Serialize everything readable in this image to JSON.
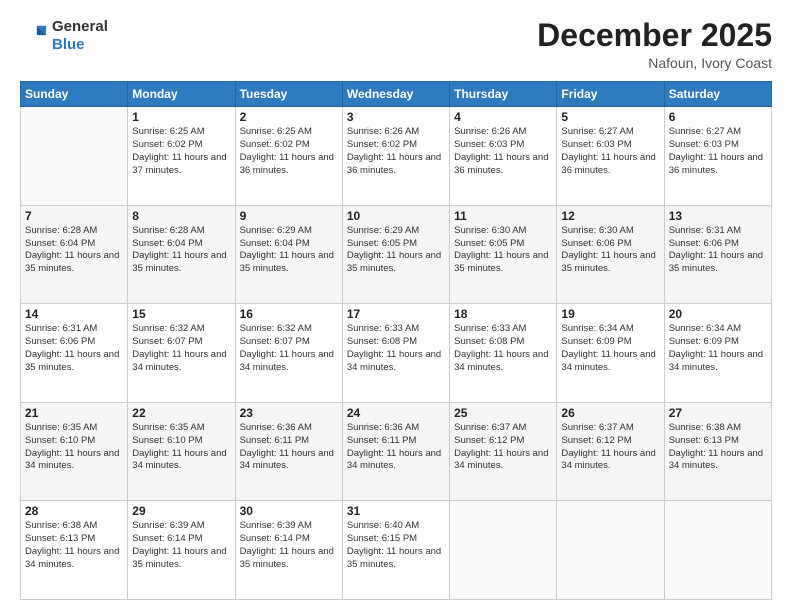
{
  "logo": {
    "general": "General",
    "blue": "Blue"
  },
  "header": {
    "month": "December 2025",
    "location": "Nafoun, Ivory Coast"
  },
  "weekdays": [
    "Sunday",
    "Monday",
    "Tuesday",
    "Wednesday",
    "Thursday",
    "Friday",
    "Saturday"
  ],
  "weeks": [
    [
      {
        "day": "",
        "empty": true
      },
      {
        "day": "1",
        "sunrise": "Sunrise: 6:25 AM",
        "sunset": "Sunset: 6:02 PM",
        "daylight": "Daylight: 11 hours and 37 minutes."
      },
      {
        "day": "2",
        "sunrise": "Sunrise: 6:25 AM",
        "sunset": "Sunset: 6:02 PM",
        "daylight": "Daylight: 11 hours and 36 minutes."
      },
      {
        "day": "3",
        "sunrise": "Sunrise: 6:26 AM",
        "sunset": "Sunset: 6:02 PM",
        "daylight": "Daylight: 11 hours and 36 minutes."
      },
      {
        "day": "4",
        "sunrise": "Sunrise: 6:26 AM",
        "sunset": "Sunset: 6:03 PM",
        "daylight": "Daylight: 11 hours and 36 minutes."
      },
      {
        "day": "5",
        "sunrise": "Sunrise: 6:27 AM",
        "sunset": "Sunset: 6:03 PM",
        "daylight": "Daylight: 11 hours and 36 minutes."
      },
      {
        "day": "6",
        "sunrise": "Sunrise: 6:27 AM",
        "sunset": "Sunset: 6:03 PM",
        "daylight": "Daylight: 11 hours and 36 minutes."
      }
    ],
    [
      {
        "day": "7",
        "sunrise": "Sunrise: 6:28 AM",
        "sunset": "Sunset: 6:04 PM",
        "daylight": "Daylight: 11 hours and 35 minutes."
      },
      {
        "day": "8",
        "sunrise": "Sunrise: 6:28 AM",
        "sunset": "Sunset: 6:04 PM",
        "daylight": "Daylight: 11 hours and 35 minutes."
      },
      {
        "day": "9",
        "sunrise": "Sunrise: 6:29 AM",
        "sunset": "Sunset: 6:04 PM",
        "daylight": "Daylight: 11 hours and 35 minutes."
      },
      {
        "day": "10",
        "sunrise": "Sunrise: 6:29 AM",
        "sunset": "Sunset: 6:05 PM",
        "daylight": "Daylight: 11 hours and 35 minutes."
      },
      {
        "day": "11",
        "sunrise": "Sunrise: 6:30 AM",
        "sunset": "Sunset: 6:05 PM",
        "daylight": "Daylight: 11 hours and 35 minutes."
      },
      {
        "day": "12",
        "sunrise": "Sunrise: 6:30 AM",
        "sunset": "Sunset: 6:06 PM",
        "daylight": "Daylight: 11 hours and 35 minutes."
      },
      {
        "day": "13",
        "sunrise": "Sunrise: 6:31 AM",
        "sunset": "Sunset: 6:06 PM",
        "daylight": "Daylight: 11 hours and 35 minutes."
      }
    ],
    [
      {
        "day": "14",
        "sunrise": "Sunrise: 6:31 AM",
        "sunset": "Sunset: 6:06 PM",
        "daylight": "Daylight: 11 hours and 35 minutes."
      },
      {
        "day": "15",
        "sunrise": "Sunrise: 6:32 AM",
        "sunset": "Sunset: 6:07 PM",
        "daylight": "Daylight: 11 hours and 34 minutes."
      },
      {
        "day": "16",
        "sunrise": "Sunrise: 6:32 AM",
        "sunset": "Sunset: 6:07 PM",
        "daylight": "Daylight: 11 hours and 34 minutes."
      },
      {
        "day": "17",
        "sunrise": "Sunrise: 6:33 AM",
        "sunset": "Sunset: 6:08 PM",
        "daylight": "Daylight: 11 hours and 34 minutes."
      },
      {
        "day": "18",
        "sunrise": "Sunrise: 6:33 AM",
        "sunset": "Sunset: 6:08 PM",
        "daylight": "Daylight: 11 hours and 34 minutes."
      },
      {
        "day": "19",
        "sunrise": "Sunrise: 6:34 AM",
        "sunset": "Sunset: 6:09 PM",
        "daylight": "Daylight: 11 hours and 34 minutes."
      },
      {
        "day": "20",
        "sunrise": "Sunrise: 6:34 AM",
        "sunset": "Sunset: 6:09 PM",
        "daylight": "Daylight: 11 hours and 34 minutes."
      }
    ],
    [
      {
        "day": "21",
        "sunrise": "Sunrise: 6:35 AM",
        "sunset": "Sunset: 6:10 PM",
        "daylight": "Daylight: 11 hours and 34 minutes."
      },
      {
        "day": "22",
        "sunrise": "Sunrise: 6:35 AM",
        "sunset": "Sunset: 6:10 PM",
        "daylight": "Daylight: 11 hours and 34 minutes."
      },
      {
        "day": "23",
        "sunrise": "Sunrise: 6:36 AM",
        "sunset": "Sunset: 6:11 PM",
        "daylight": "Daylight: 11 hours and 34 minutes."
      },
      {
        "day": "24",
        "sunrise": "Sunrise: 6:36 AM",
        "sunset": "Sunset: 6:11 PM",
        "daylight": "Daylight: 11 hours and 34 minutes."
      },
      {
        "day": "25",
        "sunrise": "Sunrise: 6:37 AM",
        "sunset": "Sunset: 6:12 PM",
        "daylight": "Daylight: 11 hours and 34 minutes."
      },
      {
        "day": "26",
        "sunrise": "Sunrise: 6:37 AM",
        "sunset": "Sunset: 6:12 PM",
        "daylight": "Daylight: 11 hours and 34 minutes."
      },
      {
        "day": "27",
        "sunrise": "Sunrise: 6:38 AM",
        "sunset": "Sunset: 6:13 PM",
        "daylight": "Daylight: 11 hours and 34 minutes."
      }
    ],
    [
      {
        "day": "28",
        "sunrise": "Sunrise: 6:38 AM",
        "sunset": "Sunset: 6:13 PM",
        "daylight": "Daylight: 11 hours and 34 minutes."
      },
      {
        "day": "29",
        "sunrise": "Sunrise: 6:39 AM",
        "sunset": "Sunset: 6:14 PM",
        "daylight": "Daylight: 11 hours and 35 minutes."
      },
      {
        "day": "30",
        "sunrise": "Sunrise: 6:39 AM",
        "sunset": "Sunset: 6:14 PM",
        "daylight": "Daylight: 11 hours and 35 minutes."
      },
      {
        "day": "31",
        "sunrise": "Sunrise: 6:40 AM",
        "sunset": "Sunset: 6:15 PM",
        "daylight": "Daylight: 11 hours and 35 minutes."
      },
      {
        "day": "",
        "empty": true
      },
      {
        "day": "",
        "empty": true
      },
      {
        "day": "",
        "empty": true
      }
    ]
  ]
}
